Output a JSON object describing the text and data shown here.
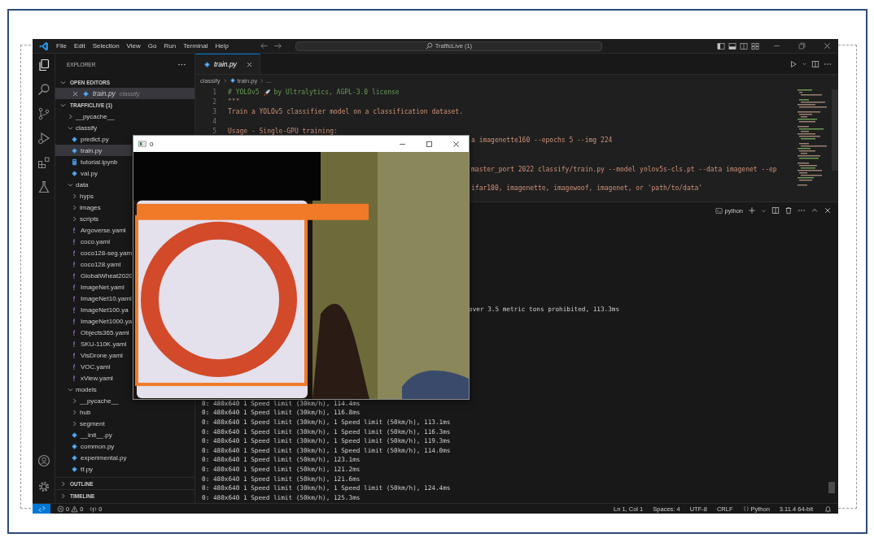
{
  "title_bar": {
    "menus": [
      "File",
      "Edit",
      "Selection",
      "View",
      "Go",
      "Run",
      "Terminal",
      "Help"
    ],
    "command_center": "TrafficLive (1)"
  },
  "sidebar": {
    "title": "EXPLORER",
    "open_editors": {
      "label": "OPEN EDITORS",
      "expanded": true,
      "items": [
        {
          "name": "train.py",
          "folder": "classify",
          "selected": true
        }
      ]
    },
    "workspace": {
      "label": "TRAFFICLIVE (1)",
      "expanded": true,
      "tree": [
        {
          "name": "__pycache__",
          "kind": "folder",
          "expanded": false
        },
        {
          "name": "classify",
          "kind": "folder",
          "expanded": true,
          "children": [
            {
              "name": "predict.py",
              "kind": "python",
              "selected": false
            },
            {
              "name": "train.py",
              "kind": "python",
              "selected": true
            },
            {
              "name": "tutorial.ipynb",
              "kind": "notebook",
              "selected": false
            },
            {
              "name": "val.py",
              "kind": "python",
              "selected": false
            }
          ]
        },
        {
          "name": "data",
          "kind": "folder",
          "expanded": true,
          "children": [
            {
              "name": "hyps",
              "kind": "folder",
              "expanded": false
            },
            {
              "name": "images",
              "kind": "folder",
              "expanded": false
            },
            {
              "name": "scripts",
              "kind": "folder",
              "expanded": false
            },
            {
              "name": "Argoverse.yaml",
              "kind": "yaml",
              "selected": false
            },
            {
              "name": "coco.yaml",
              "kind": "yaml",
              "selected": false
            },
            {
              "name": "coco128-seg.yam",
              "kind": "yaml",
              "selected": false
            },
            {
              "name": "coco128.yaml",
              "kind": "yaml",
              "selected": false
            },
            {
              "name": "GlobalWheat2020",
              "kind": "yaml",
              "selected": false
            },
            {
              "name": "ImageNet.yaml",
              "kind": "yaml",
              "selected": false
            },
            {
              "name": "ImageNet10.yaml",
              "kind": "yaml",
              "selected": false
            },
            {
              "name": "ImageNet100.ya",
              "kind": "yaml",
              "selected": false
            },
            {
              "name": "ImageNet1000.ya",
              "kind": "yaml",
              "selected": false
            },
            {
              "name": "Objects365.yaml",
              "kind": "yaml",
              "selected": false
            },
            {
              "name": "SKU-110K.yaml",
              "kind": "yaml",
              "selected": false
            },
            {
              "name": "VisDrone.yaml",
              "kind": "yaml",
              "selected": false
            },
            {
              "name": "VOC.yaml",
              "kind": "yaml",
              "selected": false
            },
            {
              "name": "xView.yaml",
              "kind": "yaml",
              "selected": false
            }
          ]
        },
        {
          "name": "models",
          "kind": "folder",
          "expanded": true,
          "children": [
            {
              "name": "__pycache__",
              "kind": "folder",
              "expanded": false
            },
            {
              "name": "hub",
              "kind": "folder",
              "expanded": false
            },
            {
              "name": "segment",
              "kind": "folder",
              "expanded": false
            },
            {
              "name": "__init__.py",
              "kind": "python",
              "selected": false
            },
            {
              "name": "common.py",
              "kind": "python",
              "selected": false
            },
            {
              "name": "experimental.py",
              "kind": "python",
              "selected": false
            },
            {
              "name": "tf.py",
              "kind": "python",
              "selected": false
            }
          ]
        }
      ]
    },
    "sections": [
      {
        "label": "OUTLINE",
        "expanded": false
      },
      {
        "label": "TIMELINE",
        "expanded": false
      }
    ]
  },
  "editor": {
    "tabs": [
      {
        "label": "train.py",
        "selected": true
      }
    ],
    "breadcrumb": [
      "classify",
      "train.py",
      "..."
    ],
    "lines": [
      {
        "number": "1",
        "kind": "comment",
        "parts": [
          "# YOLOv5",
          "by Ultralytics, AGPL-3.0 license"
        ]
      },
      {
        "number": "2",
        "kind": "string",
        "text": "\"\"\""
      },
      {
        "number": "3",
        "kind": "string",
        "text": "Train a YOLOv5 classifier model on a classification dataset."
      },
      {
        "number": "4",
        "kind": "blank"
      },
      {
        "number": "5",
        "kind": "string",
        "text": "Usage - Single-GPU training:"
      },
      {
        "kind": "clipped",
        "text": "a imagenette160 --epochs 5 --img 224"
      },
      {
        "kind": "covered"
      },
      {
        "kind": "covered"
      },
      {
        "kind": "clipped",
        "text": "master_port 2022 classify/train.py --model yolov5s-cls.pt --data imagenet --ep"
      },
      {
        "kind": "covered"
      },
      {
        "kind": "clipped",
        "text": "ifar100, imagenette, imagewoof, imagenet, or 'path/to/data'"
      }
    ]
  },
  "terminal": {
    "shell": "python",
    "lines": [
      {
        "kind": "clipped",
        "text": "over 3.5 metric tons prohibited, 113.3ms"
      },
      {
        "kind": "covered"
      },
      {
        "kind": "covered"
      },
      {
        "kind": "covered"
      },
      {
        "kind": "covered"
      },
      {
        "kind": "covered"
      },
      {
        "kind": "covered"
      },
      {
        "kind": "covered"
      },
      {
        "kind": "covered"
      },
      {
        "kind": "covered"
      },
      {
        "kind": "full",
        "text": "0: 480x640 1 Speed limit (30km/h), 114.4ms"
      },
      {
        "kind": "full",
        "text": "0: 480x640 1 Speed limit (30km/h), 116.8ms"
      },
      {
        "kind": "full",
        "text": "0: 480x640 1 Speed limit (30km/h), 1 Speed limit (50km/h), 113.1ms"
      },
      {
        "kind": "full",
        "text": "0: 480x640 1 Speed limit (30km/h), 1 Speed limit (50km/h), 116.3ms"
      },
      {
        "kind": "full",
        "text": "0: 480x640 1 Speed limit (30km/h), 1 Speed limit (50km/h), 119.3ms"
      },
      {
        "kind": "full",
        "text": "0: 480x640 1 Speed limit (30km/h), 1 Speed limit (50km/h), 114.0ms"
      },
      {
        "kind": "full",
        "text": "0: 480x640 1 Speed limit (50km/h), 123.1ms"
      },
      {
        "kind": "full",
        "text": "0: 480x640 1 Speed limit (50km/h), 121.2ms"
      },
      {
        "kind": "full",
        "text": "0: 480x640 1 Speed limit (50km/h), 121.6ms"
      },
      {
        "kind": "full",
        "text": "0: 480x640 1 Speed limit (30km/h), 1 Speed limit (50km/h), 124.4ms"
      },
      {
        "kind": "full",
        "text": "0: 480x640 1 Speed limit (50km/h), 125.3ms"
      }
    ]
  },
  "popup": {
    "title": "0"
  },
  "status_bar": {
    "errors": "0",
    "warnings": "0",
    "ports": "0",
    "items": [
      "Ln 1, Col 1",
      "Spaces: 4",
      "UTF-8",
      "CRLF"
    ],
    "language": "Python",
    "interpreter": "3.11.4 64-bit"
  }
}
